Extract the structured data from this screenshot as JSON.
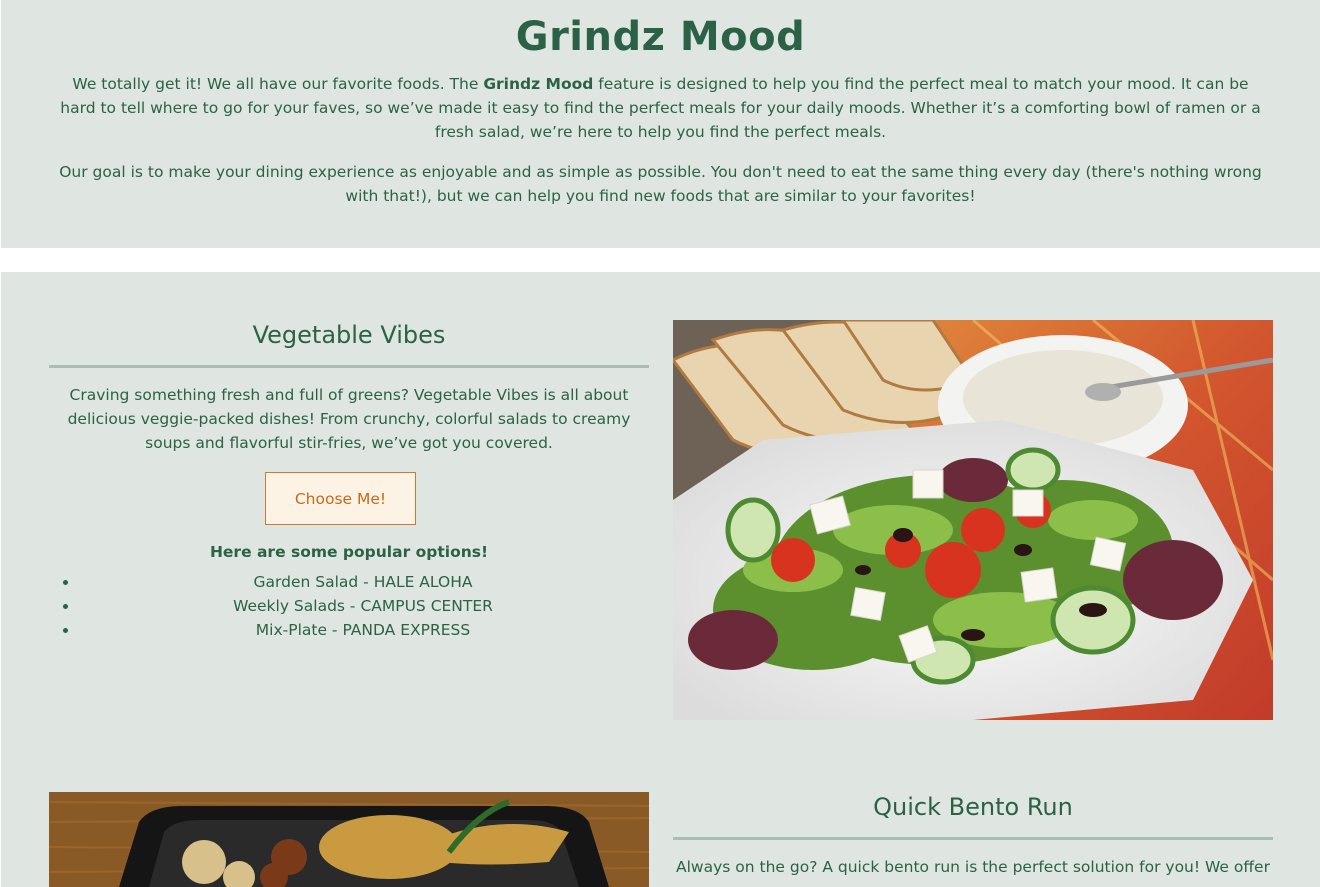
{
  "intro": {
    "title": "Grindz Mood",
    "p1_before": "We totally get it! We all have our favorite foods. The ",
    "p1_bold": "Grindz Mood",
    "p1_after": " feature is designed to help you find the perfect meal to match your mood. It can be hard to tell where to go for your faves, so we’ve made it easy to find the perfect meals for your daily moods. Whether it’s a comforting bowl of ramen or a fresh salad, we’re here to help you find the perfect meals.",
    "p2": "Our goal is to make your dining experience as enjoyable and as simple as possible. You don't need to eat the same thing every day (there's nothing wrong with that!), but we can help you find new foods that are similar to your favorites!"
  },
  "vegetable": {
    "title": "Vegetable Vibes",
    "description": "Craving something fresh and full of greens? Vegetable Vibes is all about delicious veggie-packed dishes! From crunchy, colorful salads to creamy soups and flavorful stir-fries, we’ve got you covered.",
    "button_label": "Choose Me!",
    "popular_heading": "Here are some popular options!",
    "options": [
      "Garden Salad - HALE ALOHA",
      "Weekly Salads - CAMPUS CENTER",
      "Mix-Plate - PANDA EXPRESS"
    ]
  },
  "bento": {
    "title": "Quick Bento Run",
    "description": "Always on the go? A quick bento run is the perfect solution for you! We offer a"
  },
  "colors": {
    "page_bg": "#ffffff",
    "section_bg": "#dfe6e1",
    "text_green": "#2b6247",
    "rule": "#a9bdb2",
    "button_bg": "#fdf3e4",
    "button_border": "#c87a3a",
    "button_text": "#c8691f"
  },
  "icons": {
    "salad_photo": "salad-photo",
    "bento_photo": "bento-photo",
    "bullet": "bullet-dot"
  }
}
